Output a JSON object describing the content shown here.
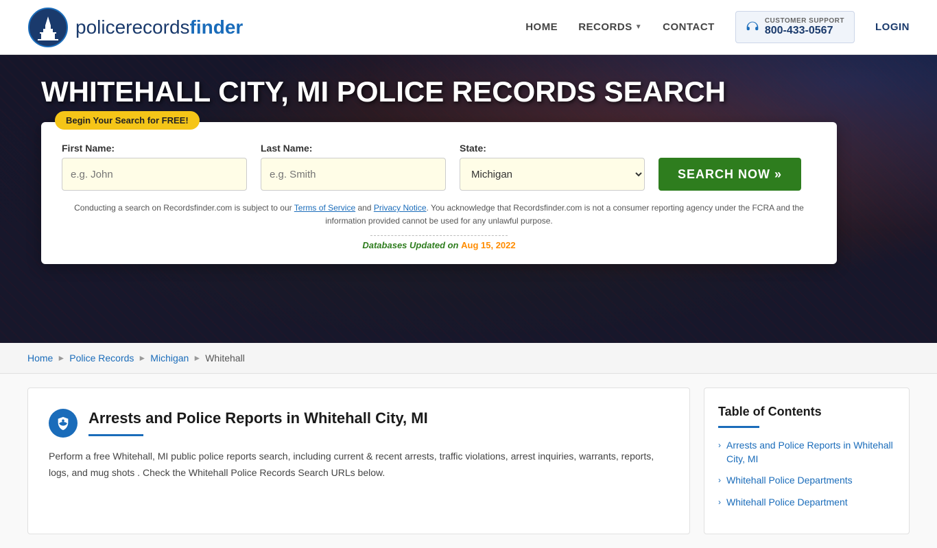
{
  "header": {
    "logo_text_light": "policerecords",
    "logo_text_bold": "finder",
    "nav": {
      "home": "HOME",
      "records": "RECORDS",
      "contact": "CONTACT",
      "login": "LOGIN"
    },
    "support": {
      "label": "CUSTOMER SUPPORT",
      "phone": "800-433-0567"
    }
  },
  "hero": {
    "title": "WHITEHALL CITY, MI POLICE RECORDS SEARCH",
    "badge_text": "Begin Your Search for FREE!",
    "fields": {
      "first_name_label": "First Name:",
      "first_name_placeholder": "e.g. John",
      "last_name_label": "Last Name:",
      "last_name_placeholder": "e.g. Smith",
      "state_label": "State:",
      "state_value": "Michigan"
    },
    "search_button": "SEARCH NOW »",
    "disclaimer": "Conducting a search on Recordsfinder.com is subject to our Terms of Service and Privacy Notice. You acknowledge that Recordsfinder.com is not a consumer reporting agency under the FCRA and the information provided cannot be used for any unlawful purpose.",
    "db_updated_label": "Databases Updated on",
    "db_updated_date": "Aug 15, 2022"
  },
  "breadcrumb": {
    "home": "Home",
    "police_records": "Police Records",
    "michigan": "Michigan",
    "current": "Whitehall"
  },
  "article": {
    "title": "Arrests and Police Reports in Whitehall City, MI",
    "body": "Perform a free Whitehall, MI public police reports search, including current & recent arrests, traffic violations, arrest inquiries, warrants, reports, logs, and mug shots . Check the Whitehall Police Records Search URLs below."
  },
  "toc": {
    "title": "Table of Contents",
    "items": [
      "Arrests and Police Reports in Whitehall City, MI",
      "Whitehall Police Departments",
      "Whitehall Police Department"
    ]
  }
}
